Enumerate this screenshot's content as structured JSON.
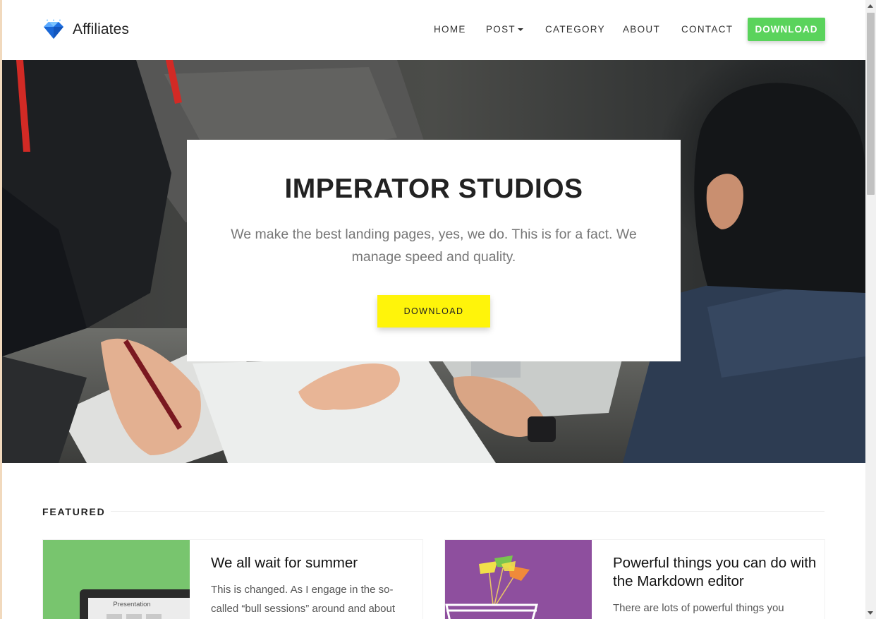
{
  "brand": {
    "name": "Affiliates",
    "logo_icon": "diamond-icon"
  },
  "nav": {
    "items": [
      {
        "label": "HOME"
      },
      {
        "label": "POST"
      },
      {
        "label": "CATEGORY"
      },
      {
        "label": "ABOUT"
      },
      {
        "label": "CONTACT"
      }
    ],
    "download_label": "DOWNLOAD"
  },
  "hero": {
    "title": "IMPERATOR STUDIOS",
    "subtitle": "We make the best landing pages, yes, we do. This is for a fact. We manage speed and quality.",
    "button_label": "DOWNLOAD"
  },
  "featured": {
    "heading": "FEATURED",
    "posts": [
      {
        "title": "We all wait for summer",
        "excerpt": "This is changed. As I engage in the so-called “bull sessions” around and about",
        "thumb_label": "Presentation",
        "thumb_color": "#78c56e"
      },
      {
        "title": "Powerful things you can do with the Markdown editor",
        "excerpt": "There are lots of powerful things you",
        "thumb_color": "#8e4f9e"
      }
    ]
  },
  "colors": {
    "nav_download_bg": "#5ad35c",
    "hero_button_bg": "#fff40a"
  }
}
